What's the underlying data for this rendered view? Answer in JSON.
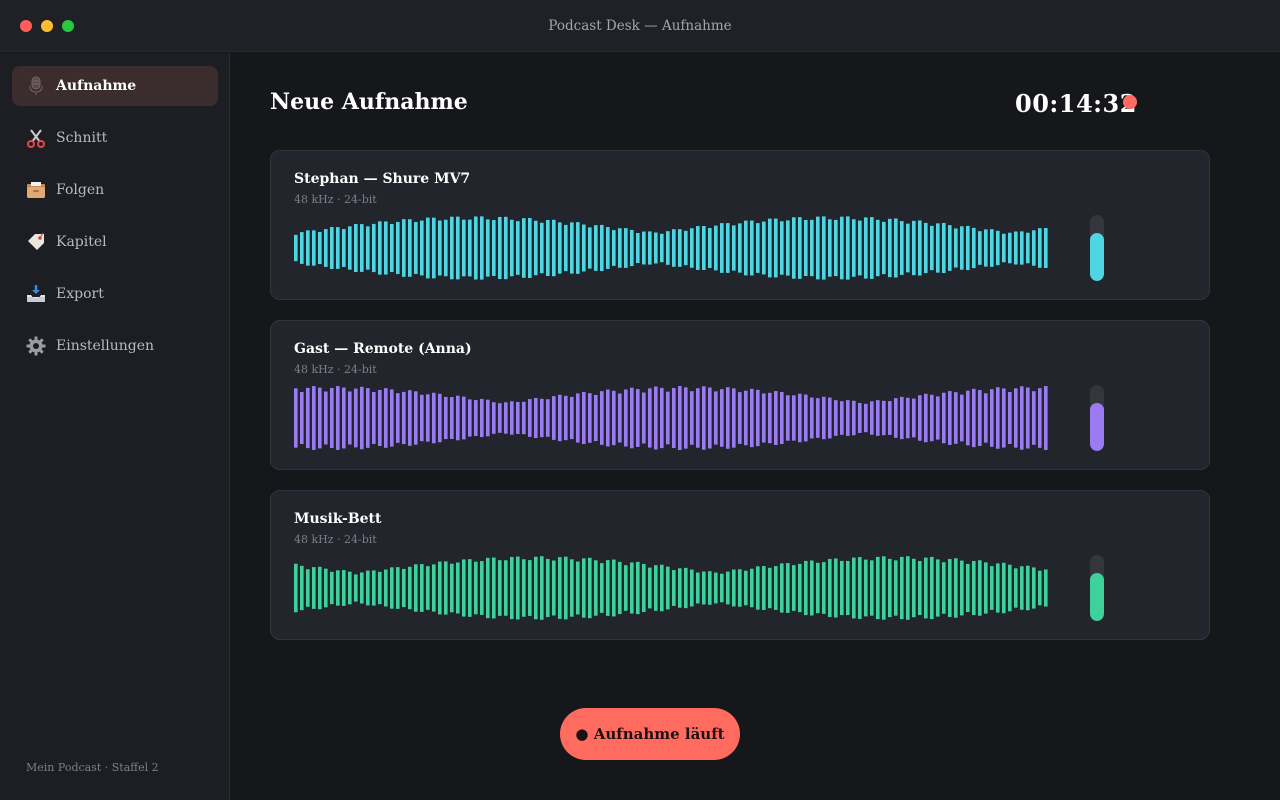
{
  "window": {
    "title": "Podcast Desk — Aufnahme"
  },
  "sidebar": {
    "items": [
      {
        "label": "Aufnahme",
        "icon": "microphone-icon",
        "active": true
      },
      {
        "label": "Schnitt",
        "icon": "scissors-icon",
        "active": false
      },
      {
        "label": "Folgen",
        "icon": "folder-icon",
        "active": false
      },
      {
        "label": "Kapitel",
        "icon": "tag-icon",
        "active": false
      },
      {
        "label": "Export",
        "icon": "inbox-tray-icon",
        "active": false
      },
      {
        "label": "Einstellungen",
        "icon": "gear-icon",
        "active": false
      }
    ],
    "footer": "Mein Podcast · Staffel 2"
  },
  "main": {
    "title": "Neue Aufnahme",
    "timer": "00:14:32",
    "tracks": [
      {
        "name": "Stephan — Shure MV7",
        "meta": "48 kHz · 24-bit",
        "color": "#4fd6e3",
        "level": 0.73,
        "phase": 0.0
      },
      {
        "name": "Gast — Remote (Anna)",
        "meta": "48 kHz · 24-bit",
        "color": "#9b7bf2",
        "level": 0.73,
        "phase": 1.3
      },
      {
        "name": "Musik-Bett",
        "meta": "48 kHz · 24-bit",
        "color": "#3fd19c",
        "level": 0.73,
        "phase": 2.6
      }
    ],
    "record_button": "● Aufnahme läuft"
  },
  "colors": {
    "accent": "#ff6b5e",
    "active_nav_bg": "#3b2c2e"
  }
}
